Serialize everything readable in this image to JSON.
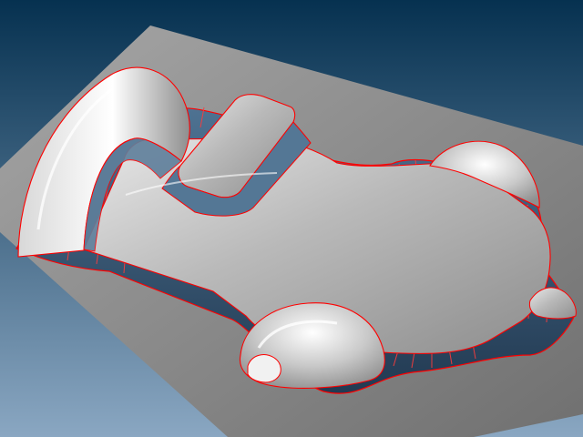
{
  "viewport": {
    "background_top": "#063150",
    "background_bottom": "#8aa7c2"
  },
  "model": {
    "base_plate_color": "#8c8c8c",
    "surface_color": "#b8b8b8",
    "highlight_color": "#f2f2f2",
    "shadow_color": "#5f7f9b",
    "edge_line_color": "#ff0000"
  }
}
